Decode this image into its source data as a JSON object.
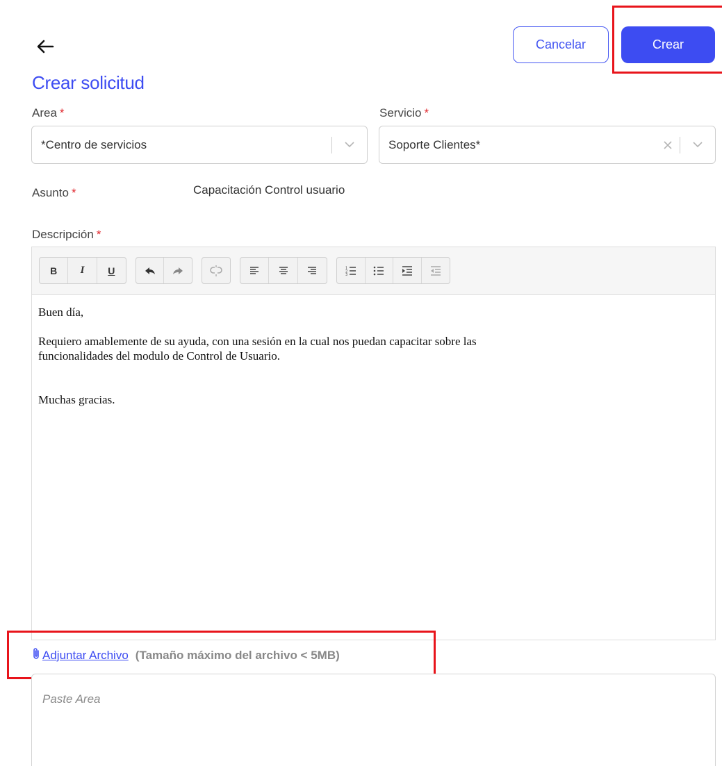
{
  "header": {
    "back_icon": "arrow-left-icon",
    "cancel_label": "Cancelar",
    "create_label": "Crear"
  },
  "page_title": "Crear solicitud",
  "form": {
    "area": {
      "label": "Area",
      "required_mark": "*",
      "value": "*Centro de servicios"
    },
    "servicio": {
      "label": "Servicio",
      "required_mark": "*",
      "value": "Soporte Clientes*"
    },
    "asunto": {
      "label": "Asunto",
      "required_mark": "*",
      "value": "Capacitación Control usuario"
    },
    "descripcion": {
      "label": "Descripción",
      "required_mark": "*",
      "toolbar": {
        "bold": "B",
        "italic": "I",
        "underline": "U"
      },
      "body": {
        "line1": "Buen día,",
        "line2": "Requiero amablemente de su ayuda, con una sesión en la cual nos puedan capacitar sobre las",
        "line3": "funcionalidades del modulo de Control de Usuario.",
        "line4": "Muchas gracias."
      }
    },
    "attach": {
      "icon": "paperclip-icon",
      "link_label": "Adjuntar Archivo",
      "note": "(Tamaño máximo del archivo < 5MB)"
    },
    "paste_area": {
      "placeholder": "Paste Area"
    }
  },
  "colors": {
    "accent": "#3d4cf2",
    "required": "#e0282e",
    "highlight": "#e8141b"
  }
}
